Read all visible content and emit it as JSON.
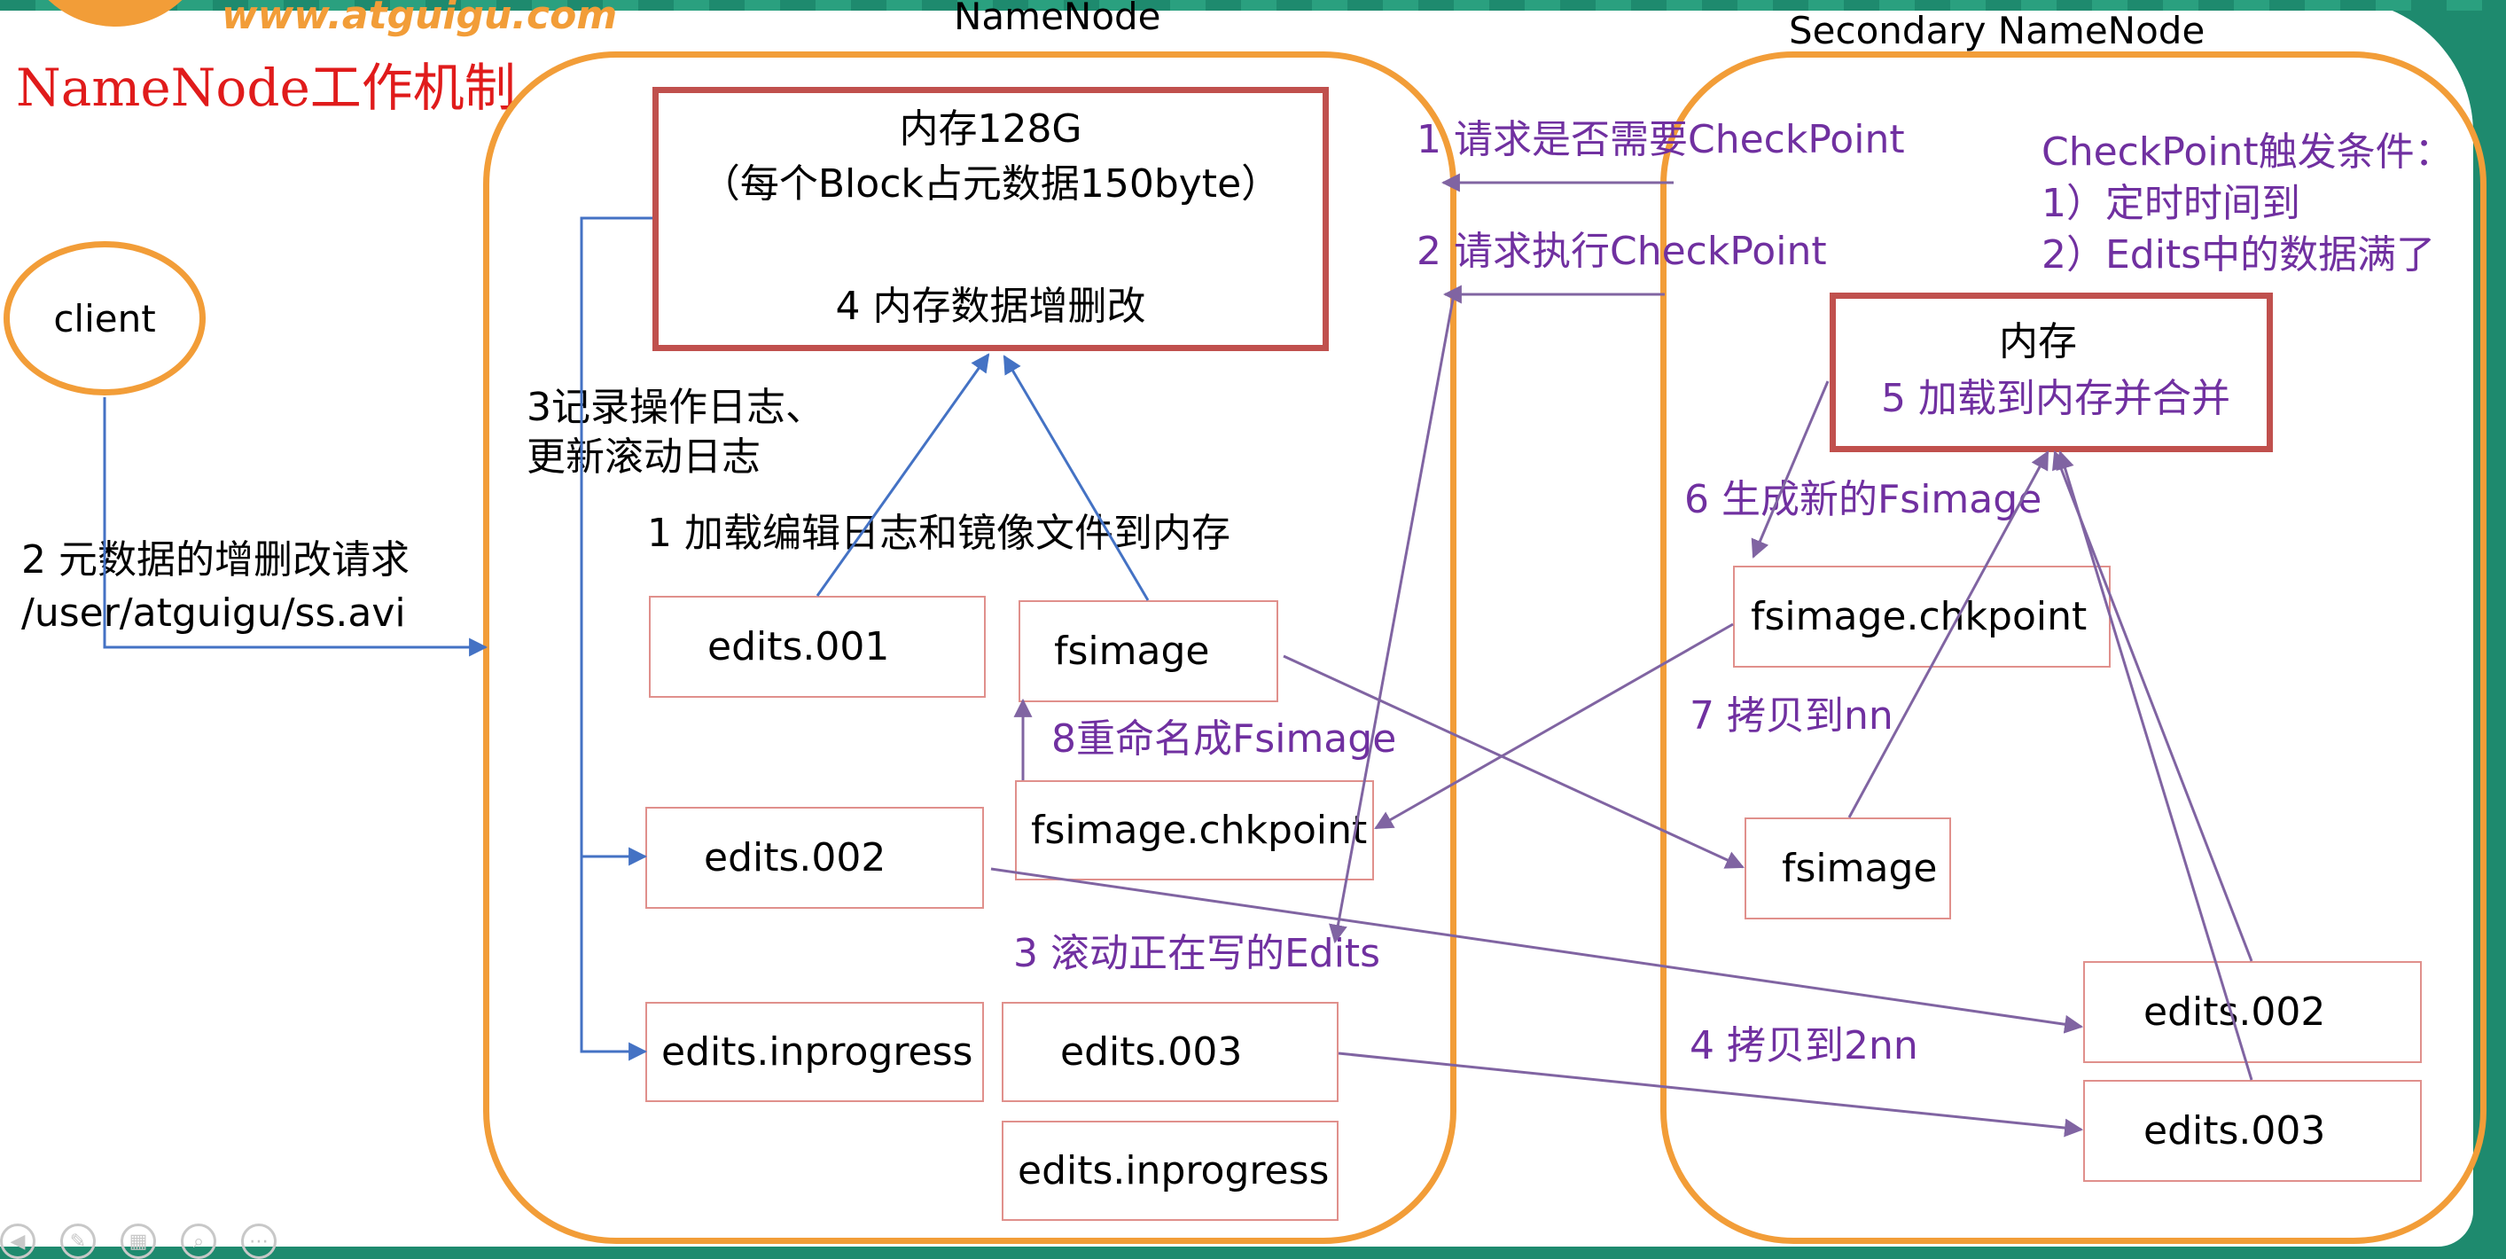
{
  "header": {
    "logo_text": "www.atguigu.com",
    "title": "NameNode工作机制"
  },
  "client": {
    "label": "client"
  },
  "namenode": {
    "title": "NameNode",
    "memory": {
      "line1": "内存128G",
      "line2": "（每个Block占元数据150byte）",
      "line3": "4 内存数据增删改"
    },
    "files": {
      "edits_001": "edits.001",
      "fsimage": "fsimage",
      "edits_002": "edits.002",
      "fsimage_chkpoint": "fsimage.chkpoint",
      "edits_inprogress_left": "edits.inprogress",
      "edits_003": "edits.003",
      "edits_inprogress_right": "edits.inprogress"
    },
    "labels": {
      "log_record_line1": "3记录操作日志、",
      "log_record_line2": "更新滚动日志",
      "load_edits": "1 加载编辑日志和镜像文件到内存",
      "rename": "8重命名成Fsimage",
      "roll_edits": "3 滚动正在写的Edits"
    }
  },
  "client_request": {
    "line1": "2 元数据的增删改请求",
    "line2": "/user/atguigu/ss.avi"
  },
  "middle_labels": {
    "ask_checkpoint": "1 请求是否需要CheckPoint",
    "do_checkpoint": "2 请求执行CheckPoint"
  },
  "secondary": {
    "title": "Secondary NameNode",
    "trigger": {
      "line1": "CheckPoint触发条件：",
      "line2": "1）定时时间到",
      "line3": "2）Edits中的数据满了"
    },
    "memory": {
      "line1": "内存",
      "line2": "5 加载到内存并合并"
    },
    "files": {
      "fsimage_chkpoint": "fsimage.chkpoint",
      "fsimage": "fsimage",
      "edits_002": "edits.002",
      "edits_003": "edits.003"
    },
    "labels": {
      "gen_fsimage": "6 生成新的Fsimage",
      "copy_to_nn": "7 拷贝到nn",
      "copy_to_2nn": "4 拷贝到2nn"
    }
  },
  "colors": {
    "orange": "#f29d38",
    "red_box": "#c0504d",
    "purple": "#7030a0",
    "arrow_blue": "#4472c4",
    "arrow_purple": "#8064a2"
  }
}
